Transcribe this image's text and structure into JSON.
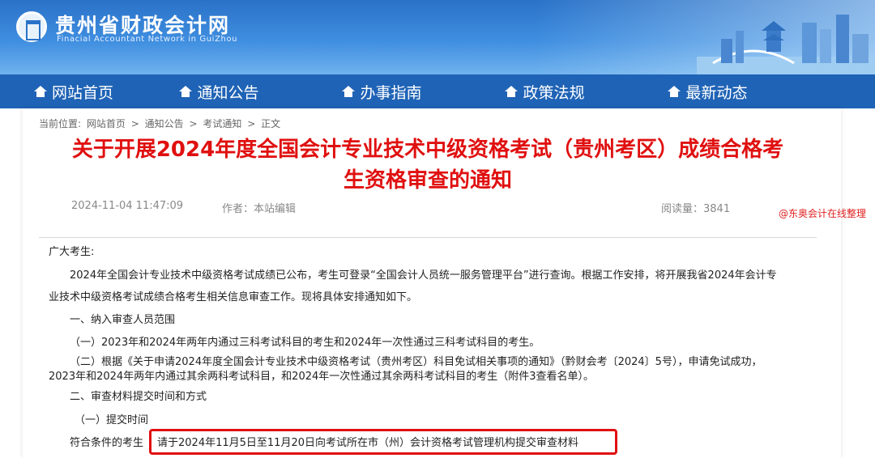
{
  "header": {
    "site_title": "贵州省财政会计网",
    "site_subtitle": "Finacial  Accountant Network in GuiZhou"
  },
  "nav": {
    "items": [
      {
        "label": "网站首页"
      },
      {
        "label": "通知公告"
      },
      {
        "label": "办事指南"
      },
      {
        "label": "政策法规"
      },
      {
        "label": "最新动态"
      }
    ]
  },
  "breadcrumb": {
    "prefix": "当前位置:",
    "items": [
      "网站首页",
      "通知公告",
      "考试通知",
      "正文"
    ],
    "separator": ">"
  },
  "article": {
    "title_line1": "关于开展2024年度全国会计专业技术中级资格考试（贵州考区）成绩合格考",
    "title_line2": "生资格审查的通知",
    "date": "2024-11-04 11:47:09",
    "author": "作者：本站编辑",
    "read_count": "阅读量：3841",
    "source_note": "@东奥会计在线整理",
    "salutation": "广大考生:",
    "para1_line1": "2024年全国会计专业技术中级资格考试成绩已公布，考生可登录“全国会计人员统一服务管理平台”进行查询。根据工作安排，将开展我省2024年会计专",
    "para1_line2": "业技术中级资格考试成绩合格考生相关信息审查工作。现将具体安排通知如下。",
    "section1": "一、纳入审查人员范围",
    "item1": "（一）2023年和2024年两年内通过三科考试科目的考生和2024年一次性通过三科考试科目的考生。",
    "item2_line1": "（二）根据《关于申请2024年度全国会计专业技术中级资格考试（贵州考区）科目免试相关事项的通知》（黔财会考〔2024〕5号），申请免试成功，",
    "item2_line2": "2023年和2024年两年内通过其余两科考试科目，和2024年一次性通过其余两科考试科目的考生（附件3查看名单）。",
    "section2": "二、审查材料提交时间和方式",
    "sub1": "（一）提交时间",
    "last_line_prefix": "符合条件的考生",
    "highlight_text": "请于2024年11月5日至11月20日向考试所在市（州）会计资格考试管理机构提交审查材料"
  },
  "colors": {
    "banner_blue": "#2a72c8",
    "nav_blue": "#1f63b6",
    "title_red": "#e01010"
  }
}
